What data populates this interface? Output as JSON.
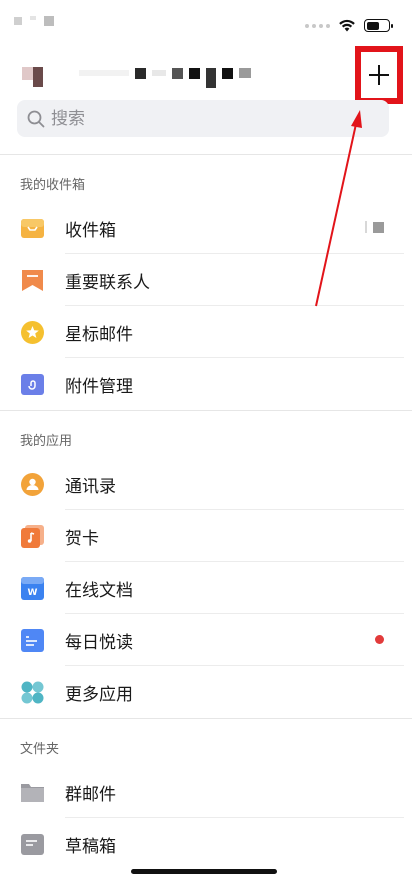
{
  "status_bar": {
    "battery_level_pct": 60
  },
  "header": {
    "add_button_label": "+"
  },
  "search": {
    "placeholder": "搜索"
  },
  "sections": {
    "inbox": {
      "title": "我的收件箱",
      "items": [
        {
          "label": "收件箱",
          "icon": "inbox-tray-icon"
        },
        {
          "label": "重要联系人",
          "icon": "bookmark-ribbon-icon"
        },
        {
          "label": "星标邮件",
          "icon": "star-icon"
        },
        {
          "label": "附件管理",
          "icon": "paperclip-icon"
        }
      ]
    },
    "apps": {
      "title": "我的应用",
      "items": [
        {
          "label": "通讯录",
          "icon": "contacts-icon"
        },
        {
          "label": "贺卡",
          "icon": "music-card-icon"
        },
        {
          "label": "在线文档",
          "icon": "word-doc-icon"
        },
        {
          "label": "每日悦读",
          "icon": "reader-icon",
          "has_new_badge": true
        },
        {
          "label": "更多应用",
          "icon": "more-apps-icon"
        }
      ]
    },
    "folders": {
      "title": "文件夹",
      "items": [
        {
          "label": "群邮件",
          "icon": "folder-icon"
        },
        {
          "label": "草稿箱",
          "icon": "draft-icon"
        }
      ]
    }
  },
  "colors": {
    "annotation_red": "#e2141a",
    "badge_red": "#e23b3b",
    "inbox_orange": "#f5b342",
    "ribbon_orange": "#f08a4b",
    "star_yellow": "#f5c02f",
    "attach_blue": "#6b7fe8",
    "contacts_orange": "#f2a33a",
    "card_orange": "#f07a3a",
    "doc_blue": "#3b82f0",
    "reader_blue": "#4f87f5",
    "more_teal": "#4fb5c4",
    "folder_gray": "#9a9aa0"
  }
}
